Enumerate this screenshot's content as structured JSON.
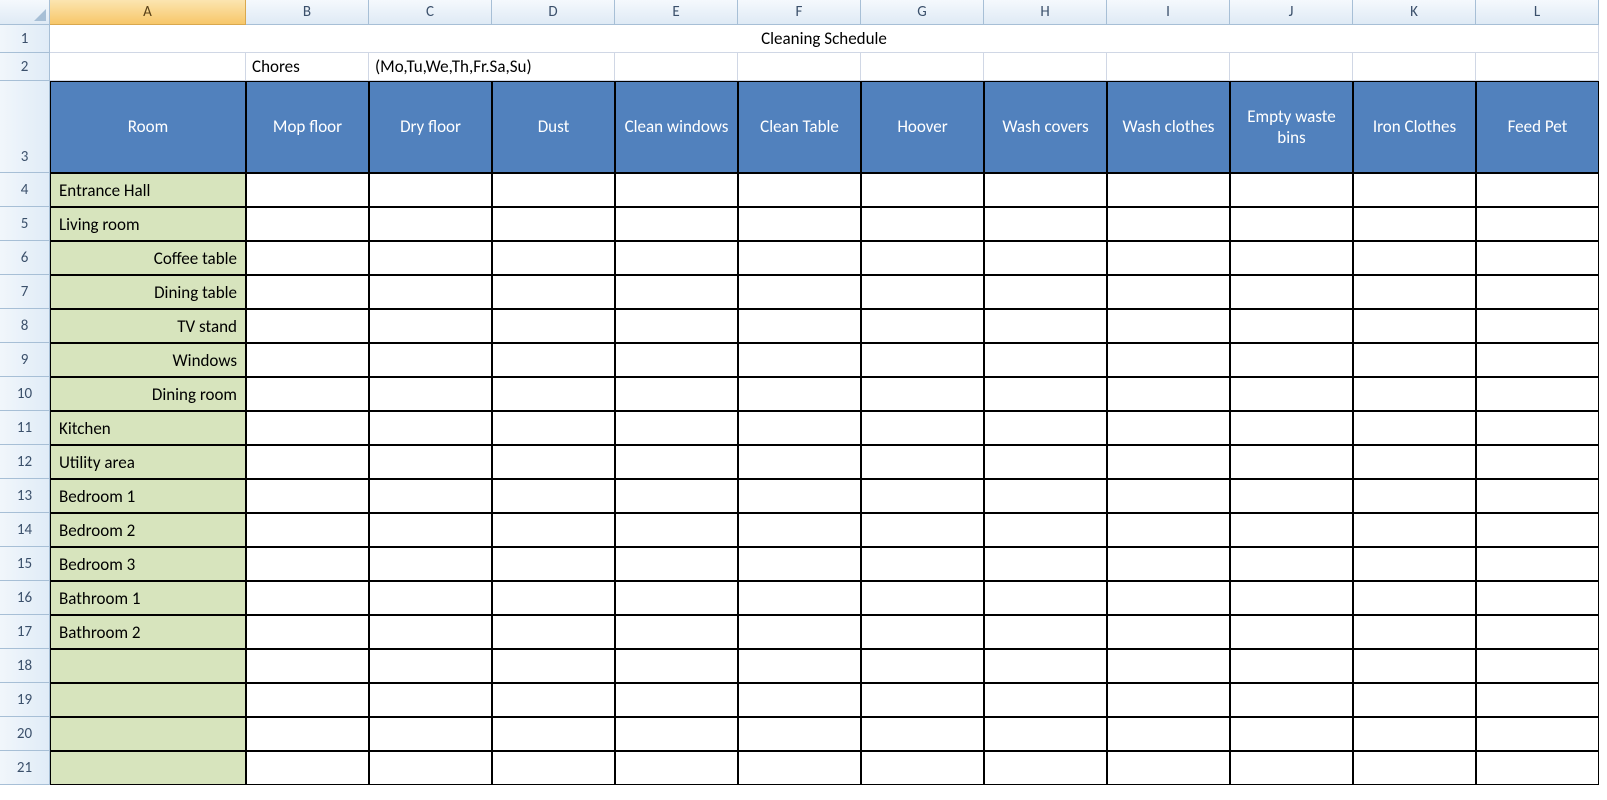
{
  "columns": [
    "A",
    "B",
    "C",
    "D",
    "E",
    "F",
    "G",
    "H",
    "I",
    "J",
    "K",
    "L"
  ],
  "row_numbers": [
    1,
    2,
    3,
    4,
    5,
    6,
    7,
    8,
    9,
    10,
    11,
    12,
    13,
    14,
    15,
    16,
    17,
    18,
    19,
    20,
    21
  ],
  "title": "Cleaning Schedule",
  "row2": {
    "b": "Chores",
    "c": "(Mo,Tu,We,Th,Fr.Sa,Su)"
  },
  "table_headers": [
    "Room",
    "Mop floor",
    "Dry floor",
    "Dust",
    "Clean windows",
    "Clean Table",
    "Hoover",
    "Wash covers",
    "Wash clothes",
    "Empty waste bins",
    "Iron Clothes",
    "Feed Pet"
  ],
  "rooms": [
    {
      "label": "Entrance Hall",
      "indent": false
    },
    {
      "label": "Living room",
      "indent": false
    },
    {
      "label": "Coffee table",
      "indent": true
    },
    {
      "label": "Dining table",
      "indent": true
    },
    {
      "label": "TV stand",
      "indent": true
    },
    {
      "label": "Windows",
      "indent": true
    },
    {
      "label": "Dining room",
      "indent": true
    },
    {
      "label": "Kitchen",
      "indent": false
    },
    {
      "label": "Utility area",
      "indent": false
    },
    {
      "label": "Bedroom 1",
      "indent": false
    },
    {
      "label": "Bedroom 2",
      "indent": false
    },
    {
      "label": "Bedroom 3",
      "indent": false
    },
    {
      "label": "Bathroom 1",
      "indent": false
    },
    {
      "label": "Bathroom 2",
      "indent": false
    },
    {
      "label": "",
      "indent": false
    },
    {
      "label": "",
      "indent": false
    },
    {
      "label": "",
      "indent": false
    },
    {
      "label": "",
      "indent": false
    }
  ],
  "header_row_height": 92,
  "selected_column": "A"
}
